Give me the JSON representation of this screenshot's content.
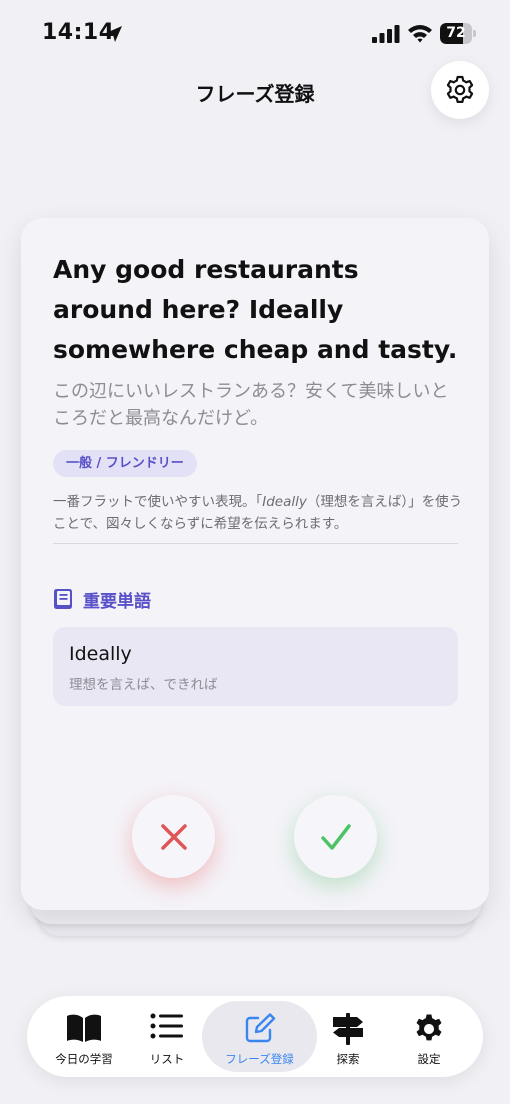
{
  "status_bar": {
    "time": "14:14",
    "battery": "72",
    "battery_level": 0.72
  },
  "header": {
    "title": "フレーズ登録"
  },
  "card": {
    "phrase_en": "Any good restaurants around here? Ideally somewhere cheap and tasty.",
    "phrase_ja": "この辺にいいレストランある？安くて美味しいところだと最高なんだけど。",
    "tag": "一般 / フレンドリー",
    "description_pre": "一番フラットで使いやすい表現。「",
    "description_em": "Ideally",
    "description_post": "（理想を言えば）」を使うことで、図々しくならずに希望を伝えられます。",
    "vocab_title": "重要単語",
    "vocab": [
      {
        "word": "Ideally",
        "meaning": "理想を言えば、できれば"
      }
    ]
  },
  "tabs": [
    {
      "label": "今日の学習",
      "icon": "book-icon"
    },
    {
      "label": "リスト",
      "icon": "list-icon"
    },
    {
      "label": "フレーズ登録",
      "icon": "edit-icon",
      "active": true
    },
    {
      "label": "探索",
      "icon": "signpost-icon"
    },
    {
      "label": "設定",
      "icon": "gear-icon"
    }
  ],
  "colors": {
    "accent": "#5850c8",
    "active_tab": "#3a86f0",
    "reject": "#e05555",
    "accept": "#4cc364"
  }
}
